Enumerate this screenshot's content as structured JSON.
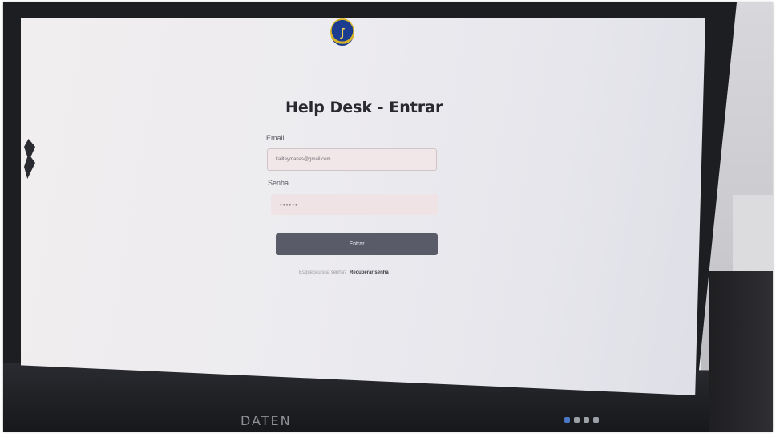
{
  "page": {
    "title": "Help Desk - Entrar"
  },
  "form": {
    "email_label": "Email",
    "email_value": "kaliteymanas@gmail.com",
    "password_label": "Senha",
    "password_value": "••••••",
    "submit_label": "Entrar",
    "forgot_text": "Esqueceu sua senha?",
    "forgot_link": "Recuperar senha"
  },
  "monitor": {
    "brand": "DATEN"
  },
  "icons": {
    "logo": "institution-logo-icon"
  },
  "colors": {
    "button": "#5a5b69",
    "input_bg": "#f2e7e8",
    "title": "#2a2930"
  }
}
